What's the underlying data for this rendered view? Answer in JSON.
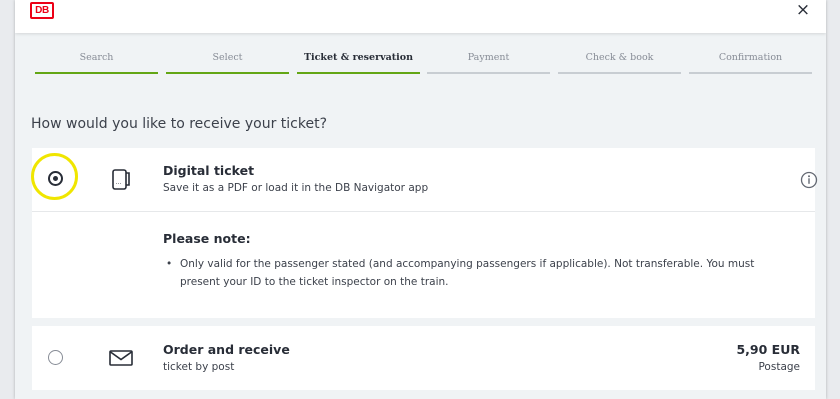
{
  "header": {
    "logo_text": "DB",
    "close_icon": "×"
  },
  "steps": [
    {
      "label": "Search",
      "state": "done"
    },
    {
      "label": "Select",
      "state": "done"
    },
    {
      "label": "Ticket & reservation",
      "state": "current"
    },
    {
      "label": "Payment",
      "state": "upcoming"
    },
    {
      "label": "Check & book",
      "state": "upcoming"
    },
    {
      "label": "Confirmation",
      "state": "upcoming"
    }
  ],
  "question": "How would you like to receive your ticket?",
  "options": {
    "digital": {
      "title": "Digital ticket",
      "subtitle": "Save it as a PDF or load it in the DB Navigator app",
      "selected": true,
      "icon": "mobile-ticket-icon",
      "note_title": "Please note:",
      "note_items": [
        "Only valid for the passenger stated (and accompanying passengers if applicable). Not transferable. You must present your ID to the ticket inspector on the train."
      ]
    },
    "post": {
      "title": "Order and receive",
      "subtitle": "ticket by post",
      "selected": false,
      "icon": "envelope-icon",
      "price": "5,90 EUR",
      "price_label": "Postage"
    }
  },
  "colors": {
    "brand_red": "#ec0016",
    "progress_green": "#63a615",
    "highlight_yellow": "#f0e600"
  }
}
